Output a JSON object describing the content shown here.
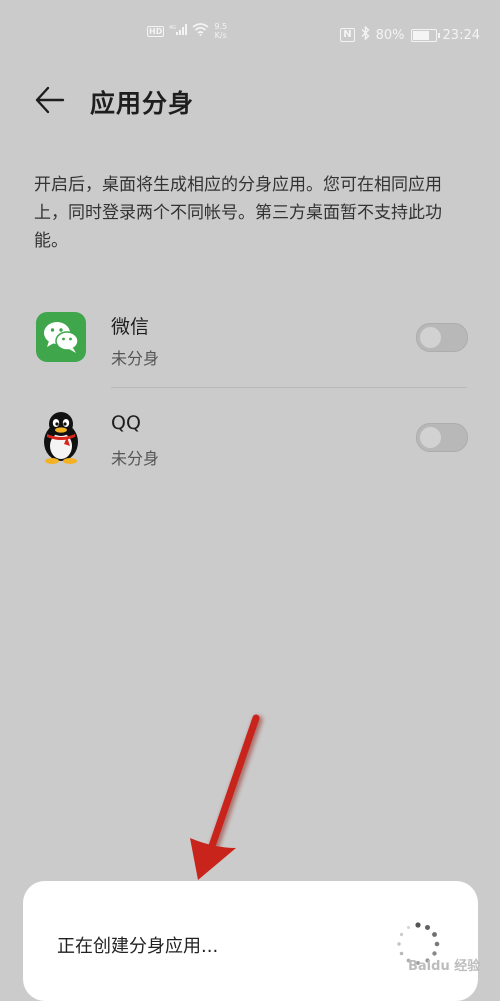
{
  "statusbar": {
    "left_badge": "HD",
    "signal_label": "4G",
    "speed_value": "9.5",
    "speed_unit": "K/s",
    "nfc": "N",
    "battery_percent": "80%",
    "battery_level": 0.8,
    "time": "23:24"
  },
  "header": {
    "title": "应用分身"
  },
  "description": "开启后，桌面将生成相应的分身应用。您可在相同应用上，同时登录两个不同帐号。第三方桌面暂不支持此功能。",
  "apps": [
    {
      "name": "微信",
      "status": "未分身",
      "icon": "wechat-icon",
      "enabled": false
    },
    {
      "name": "QQ",
      "status": "未分身",
      "icon": "qq-penguin-icon",
      "enabled": false
    }
  ],
  "toast": {
    "text": "正在创建分身应用..."
  },
  "watermark": "Baidu 经验",
  "colors": {
    "background": "#cbcbcb",
    "wechat_green": "#3fa64b",
    "arrow_red": "#c8241c",
    "toast_bg": "#ffffff"
  }
}
